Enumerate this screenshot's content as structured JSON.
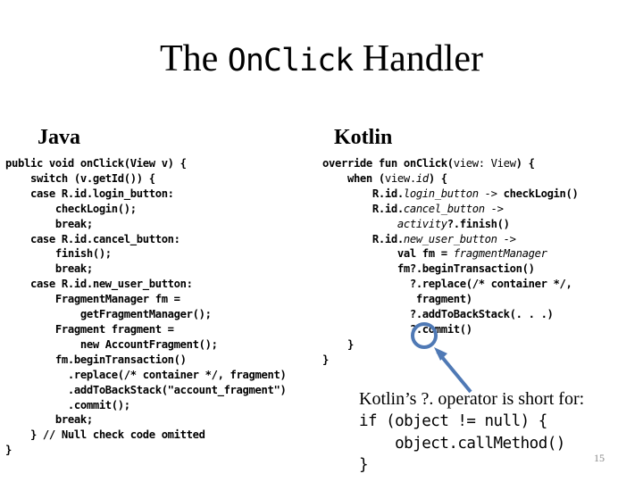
{
  "slide": {
    "title_prefix": "The ",
    "title_code": "OnClick",
    "title_suffix": " Handler",
    "page_number": "15"
  },
  "java": {
    "heading": "Java",
    "lines": [
      "public void onClick(View v) {",
      "    switch (v.getId()) {",
      "    case R.id.login_button:",
      "        checkLogin();",
      "        break;",
      "    case R.id.cancel_button:",
      "        finish();",
      "        break;",
      "    case R.id.new_user_button:",
      "        FragmentManager fm =",
      "            getFragmentManager();",
      "        Fragment fragment =",
      "            new AccountFragment();",
      "        fm.beginTransaction()",
      "          .replace(/* container */, fragment)",
      "          .addToBackStack(\"account_fragment\")",
      "          .commit();",
      "        break;",
      "    } // Null check code omitted",
      "}"
    ]
  },
  "kotlin": {
    "heading": "Kotlin",
    "lines": [
      [
        {
          "t": "override fun onClick("
        },
        {
          "t": "view: View",
          "s": "norm"
        },
        {
          "t": ") {"
        }
      ],
      [
        {
          "t": "    when ("
        },
        {
          "t": "view.",
          "s": "norm"
        },
        {
          "t": "id",
          "s": "ital"
        },
        {
          "t": ") {"
        }
      ],
      [
        {
          "t": "        R.id."
        },
        {
          "t": "login_button ->",
          "s": "ital"
        },
        {
          "t": " checkLogin()"
        }
      ],
      [
        {
          "t": "        R.id."
        },
        {
          "t": "cancel_button ->",
          "s": "ital"
        }
      ],
      [
        {
          "t": "            "
        },
        {
          "t": "activity",
          "s": "ital"
        },
        {
          "t": "?.finish()"
        }
      ],
      [
        {
          "t": "        R.id."
        },
        {
          "t": "new_user_button ->",
          "s": "ital"
        }
      ],
      [
        {
          "t": "            val fm = "
        },
        {
          "t": "fragmentManager",
          "s": "ital"
        }
      ],
      [
        {
          "t": "            fm?.beginTransaction()"
        }
      ],
      [
        {
          "t": "              ?.replace(/* container */,"
        }
      ],
      [
        {
          "t": "               fragment)"
        }
      ],
      [
        {
          "t": "              ?.addToBackStack(. . .)"
        }
      ],
      [
        {
          "t": "              ?.commit()"
        }
      ],
      [
        {
          "t": "    }"
        }
      ],
      [
        {
          "t": "}"
        }
      ]
    ]
  },
  "note": {
    "text": "Kotlin’s ?. operator is short for:",
    "code_lines": [
      "if (object != null) {",
      "    object.callMethod()",
      "}"
    ]
  },
  "annotation": {
    "color": "#4f79b5"
  }
}
